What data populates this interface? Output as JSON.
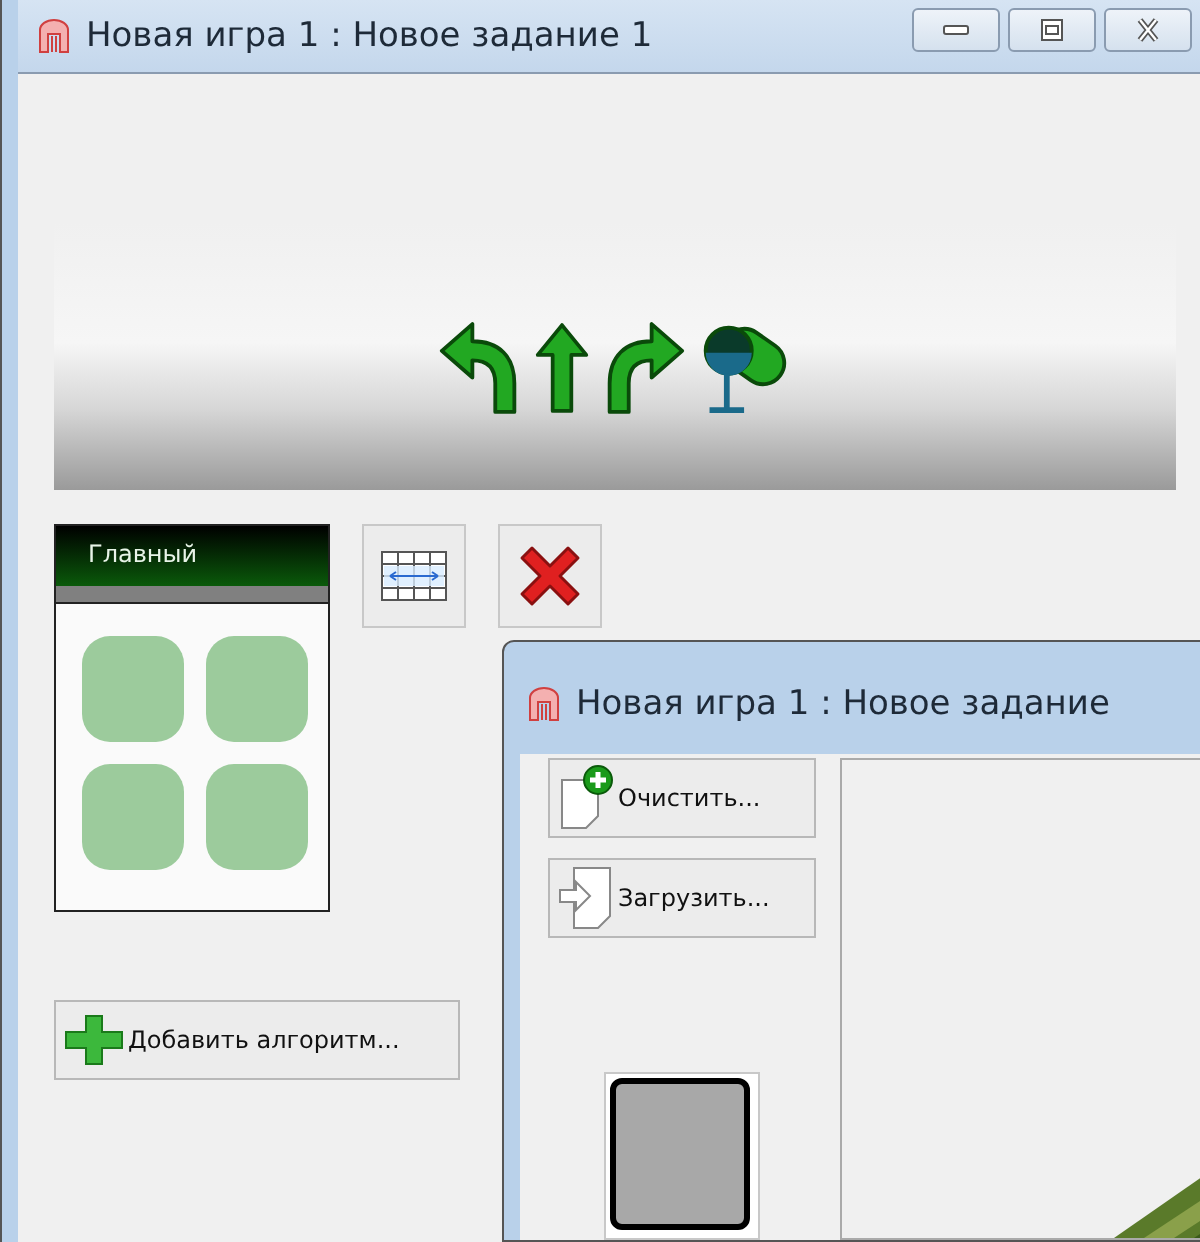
{
  "window": {
    "title": "Новая игра 1 : Новое задание 1"
  },
  "commands": [
    {
      "kind": "turn_left"
    },
    {
      "kind": "forward"
    },
    {
      "kind": "turn_right"
    },
    {
      "kind": "paint"
    }
  ],
  "algorithm": {
    "title": "Главный"
  },
  "add_button": {
    "label": "Добавить алгоритм..."
  },
  "task_window": {
    "title": "Новая игра 1 : Новое задание",
    "buttons": [
      {
        "kind": "clear",
        "label": "Очистить..."
      },
      {
        "kind": "load",
        "label": "Загрузить..."
      }
    ]
  }
}
